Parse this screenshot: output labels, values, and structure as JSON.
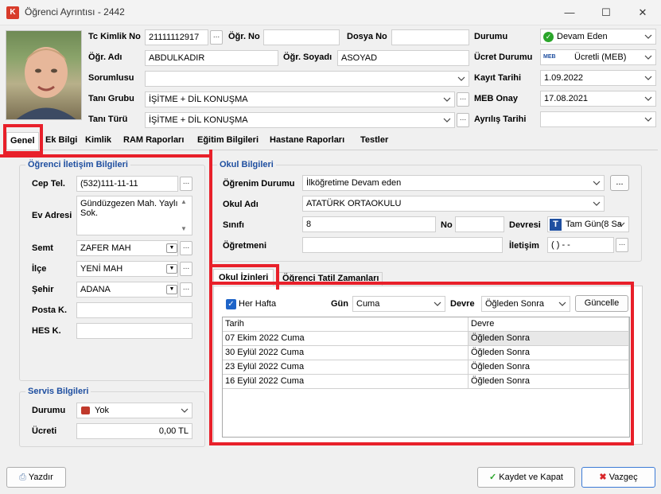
{
  "window": {
    "title": "Öğrenci Ayrıntısı - 2442",
    "app_icon_text": "K"
  },
  "top": {
    "tc_label": "Tc Kimlik No",
    "tc_value": "21111112917",
    "ogr_no_label": "Öğr. No",
    "ogr_no_value": "",
    "dosya_label": "Dosya No",
    "dosya_value": "",
    "durum_label": "Durumu",
    "durum_value": "Devam Eden",
    "ad_label": "Öğr. Adı",
    "ad_value": "ABDULKADIR",
    "soyad_label": "Öğr. Soyadı",
    "soyad_value": "ASOYAD",
    "ucret_label": "Ücret Durumu",
    "ucret_value": "Ücretli (MEB)",
    "sorumlu_label": "Sorumlusu",
    "sorumlu_value": "",
    "kayit_label": "Kayıt Tarihi",
    "kayit_value": "1.09.2022",
    "tani_grubu_label": "Tanı Grubu",
    "tani_grubu_value": "İŞİTME + DİL KONUŞMA",
    "meb_onay_label": "MEB Onay",
    "meb_onay_value": "17.08.2021",
    "tani_turu_label": "Tanı Türü",
    "tani_turu_value": "İŞİTME + DİL KONUŞMA",
    "ayrilis_label": "Ayrılış Tarihi",
    "ayrilis_value": "",
    "dots": "...",
    "meb_badge": "MEB"
  },
  "tabs": [
    "Genel",
    "Ek Bilgi",
    "Kimlik",
    "RAM Raporları",
    "Eğitim Bilgileri",
    "Hastane Raporları",
    "Testler"
  ],
  "iletisim": {
    "title": "Öğrenci İletişim Bilgileri",
    "cep_label": "Cep Tel.",
    "cep_value": "(532)111-11-11",
    "adres_label": "Ev Adresi",
    "adres_value": "Gündüzgezen Mah. Yaylı Sok.",
    "semt_label": "Semt",
    "semt_value": "ZAFER MAH",
    "ilce_label": "İlçe",
    "ilce_value": "YENİ MAH",
    "sehir_label": "Şehir",
    "sehir_value": "ADANA",
    "posta_label": "Posta K.",
    "posta_value": "",
    "hes_label": "HES K.",
    "hes_value": ""
  },
  "servis": {
    "title": "Servis Bilgileri",
    "durum_label": "Durumu",
    "durum_value": "Yok",
    "ucret_label": "Ücreti",
    "ucret_value": "0,00 TL"
  },
  "okul": {
    "title": "Okul Bilgileri",
    "ogrenim_label": "Öğrenim Durumu",
    "ogrenim_value": "İlköğretime Devam eden",
    "okul_adi_label": "Okul Adı",
    "okul_adi_value": "ATATÜRK ORTAOKULU",
    "sinif_label": "Sınıfı",
    "sinif_value": "8",
    "no_label": "No",
    "no_value": "",
    "devresi_label": "Devresi",
    "devresi_value": "Tam Gün(8 Sa",
    "devresi_badge": "T",
    "ogretmen_label": "Öğretmeni",
    "ogretmen_value": "",
    "iletisim_label": "İletişim",
    "iletisim_value": "(   )   -  -"
  },
  "subtabs": [
    "Okul İzinleri",
    "Öğrenci Tatil Zamanları"
  ],
  "izin": {
    "her_hafta_label": "Her Hafta",
    "gun_label": "Gün",
    "gun_value": "Cuma",
    "devre_label": "Devre",
    "devre_value": "Öğleden Sonra",
    "guncelle_label": "Güncelle",
    "columns": [
      "Tarih",
      "Devre"
    ],
    "rows": [
      [
        "07 Ekim 2022 Cuma",
        "Öğleden Sonra"
      ],
      [
        "30 Eylül 2022 Cuma",
        "Öğleden Sonra"
      ],
      [
        "23 Eylül 2022 Cuma",
        "Öğleden Sonra"
      ],
      [
        "16 Eylül 2022 Cuma",
        "Öğleden Sonra"
      ]
    ]
  },
  "footer": {
    "yazdir_label": "Yazdır",
    "kaydet_label": "Kaydet ve Kapat",
    "vazgec_label": "Vazgeç"
  },
  "colors": {
    "highlight": "#e8202a",
    "group_title": "#1f4fa0",
    "status_green": "#2aa52a"
  }
}
